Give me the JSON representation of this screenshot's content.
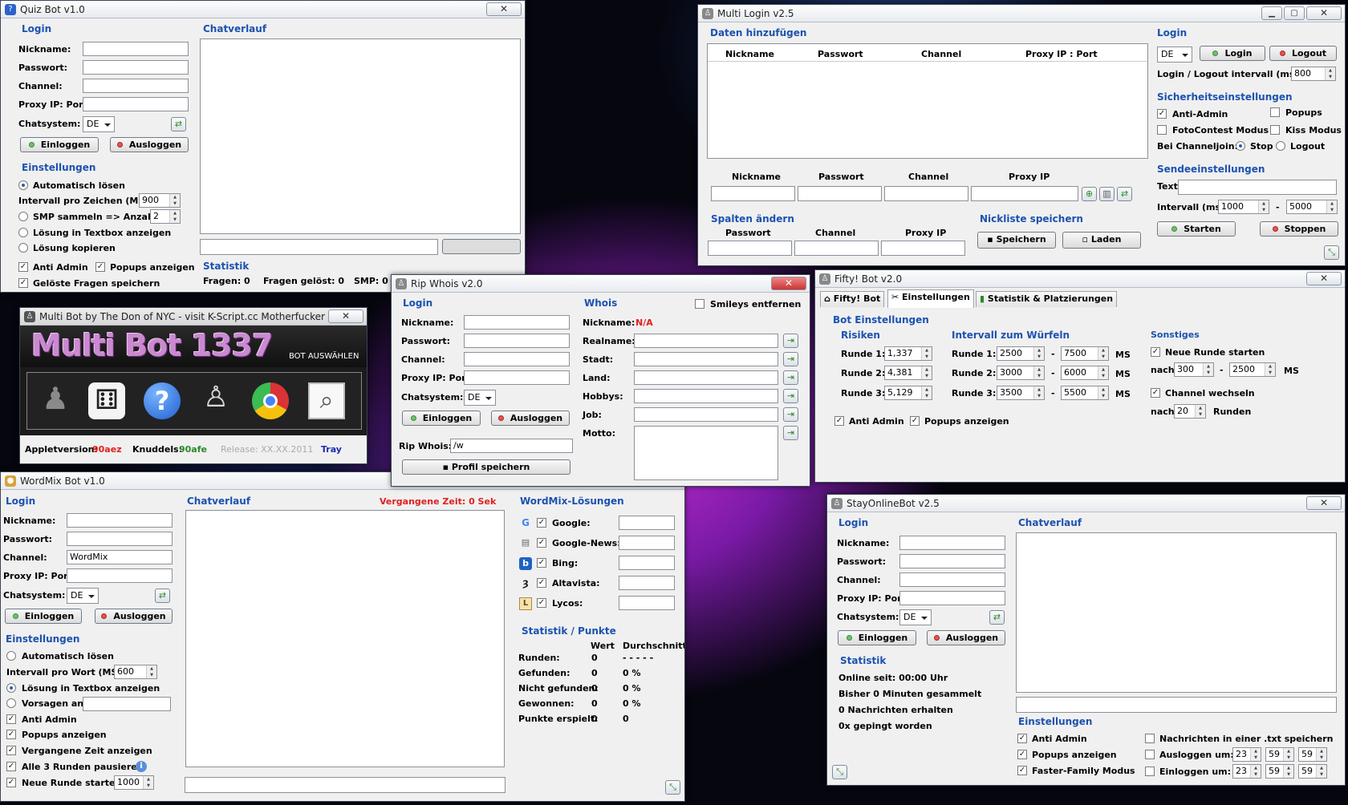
{
  "quiz": {
    "title": "Quiz Bot v1.0",
    "login": "Login",
    "nick": "Nickname:",
    "pass": "Passwort:",
    "channel": "Channel:",
    "proxy": "Proxy IP: Port:",
    "chat": "Chatsystem:",
    "chat_val": "DE",
    "einloggen": "Einloggen",
    "ausloggen": "Ausloggen",
    "einst": "Einstellungen",
    "auto": "Automatisch lösen",
    "interval": "Intervall pro Zeichen (MS):",
    "interval_val": "900",
    "smp": "SMP sammeln => Anzahl:",
    "smp_val": "2",
    "loes_tb": "Lösung in Textbox anzeigen",
    "loes_kop": "Lösung kopieren",
    "anti": "Anti Admin",
    "popups": "Popups anzeigen",
    "geloest": "Gelöste Fragen speichern",
    "chatverlauf": "Chatverlauf",
    "statistik": "Statistik",
    "fragen": "Fragen: 0",
    "fragen_gel": "Fragen gelöst: 0",
    "smp_stat": "SMP: 0"
  },
  "multilogin": {
    "title": "Multi Login v2.5",
    "daten": "Daten hinzufügen",
    "cols": [
      "Nickname",
      "Passwort",
      "Channel",
      "Proxy IP : Port"
    ],
    "cols2": [
      "Nickname",
      "Passwort",
      "Channel",
      "Proxy IP"
    ],
    "login": "Login",
    "lang": "DE",
    "login_btn": "Login",
    "logout_btn": "Logout",
    "interval_lbl": "Login / Logout intervall (ms):",
    "interval_val": "800",
    "sicher": "Sicherheitseinstellungen",
    "anti": "Anti-Admin",
    "popups": "Popups",
    "foto": "FotoContest Modus",
    "kiss": "Kiss Modus",
    "bei": "Bei Channeljoin:",
    "stop": "Stop",
    "logout": "Logout",
    "sende": "Sendeeinstellungen",
    "text": "Text",
    "intms": "Intervall (ms)",
    "int1": "1000",
    "dash": "-",
    "int2": "5000",
    "starten": "Starten",
    "stoppen": "Stoppen",
    "spalten": "Spalten ändern",
    "scol": [
      "Passwort",
      "Channel",
      "Proxy IP"
    ],
    "nickliste": "Nickliste speichern",
    "speichern": "Speichern",
    "laden": "Laden"
  },
  "multibot": {
    "title": "Multi Bot by The Don of NYC - visit K-Script.cc Motherfucker",
    "logo": "Multi Bot 1337",
    "bot_ausw": "BOT AUSWÄHLEN",
    "applet_lbl": "Appletversion:",
    "applet_val": "90aez",
    "knud_lbl": "Knuddels:",
    "knud_val": "90afe",
    "release": "Release: XX.XX.2011",
    "tray": "Tray"
  },
  "rip": {
    "title": "Rip Whois v2.0",
    "login": "Login",
    "nick": "Nickname:",
    "pass": "Passwort:",
    "channel": "Channel:",
    "proxy": "Proxy IP: Port:",
    "chat": "Chatsystem:",
    "chat_val": "DE",
    "einloggen": "Einloggen",
    "ausloggen": "Ausloggen",
    "whois_lbl": "Rip Whois:",
    "whois_val": "/w",
    "profil": "Profil speichern",
    "whois": "Whois",
    "smileys": "Smileys entfernen",
    "nick2": "Nickname:",
    "na": "N/A",
    "real": "Realname:",
    "stadt": "Stadt:",
    "land": "Land:",
    "hobbys": "Hobbys:",
    "job": "Job:",
    "motto": "Motto:"
  },
  "fifty": {
    "title": "Fifty! Bot v2.0",
    "tabs": [
      "Fifty! Bot",
      "Einstellungen",
      "Statistik & Platzierungen"
    ],
    "bot_einst": "Bot Einstellungen",
    "risiken": "Risiken",
    "r1": "Runde 1:",
    "r2": "Runde 2:",
    "r3": "Runde 3:",
    "rv1": "1,337",
    "rv2": "4,381",
    "rv3": "5,129",
    "intw": "Intervall zum Würfeln",
    "a1": "2500",
    "b1": "7500",
    "a2": "3000",
    "b2": "6000",
    "a3": "3500",
    "b3": "5500",
    "ms": "MS",
    "dash": "-",
    "sonst": "Sonstiges",
    "neue": "Neue Runde starten",
    "nach": "nach",
    "n1": "300",
    "n2": "2500",
    "chw": "Channel wechseln",
    "n3": "20",
    "runden": "Runden",
    "anti": "Anti Admin",
    "popups": "Popups anzeigen"
  },
  "wordmix": {
    "title": "WordMix Bot v1.0",
    "login": "Login",
    "nick": "Nickname:",
    "pass": "Passwort:",
    "channel": "Channel:",
    "channel_val": "WordMix",
    "proxy": "Proxy IP: Port:",
    "chat": "Chatsystem:",
    "chat_val": "DE",
    "einloggen": "Einloggen",
    "ausloggen": "Ausloggen",
    "einst": "Einstellungen",
    "auto": "Automatisch lösen",
    "interval": "Intervall pro Wort (MS):",
    "interval_val": "600",
    "loes": "Lösung in Textbox anzeigen",
    "vorsagen": "Vorsagen an:",
    "anti": "Anti Admin",
    "popups": "Popups anzeigen",
    "vergangene": "Vergangene Zeit anzeigen",
    "alle3": "Alle 3 Runden pausieren",
    "neue": "Neue Runde starten",
    "neue_val": "1000",
    "chatverlauf": "Chatverlauf",
    "zeit": "Vergangene Zeit: 0 Sek",
    "loesungen": "WordMix-Lösungen",
    "engines": [
      "Google:",
      "Google-News:",
      "Bing:",
      "Altavista:",
      "Lycos:"
    ],
    "stat": "Statistik / Punkte",
    "wert": "Wert",
    "durch": "Durchschnitt",
    "rows": [
      {
        "l": "Runden:",
        "w": "0",
        "d": "- - - - -"
      },
      {
        "l": "Gefunden:",
        "w": "0",
        "d": "0 %"
      },
      {
        "l": "Nicht gefunden:",
        "w": "0",
        "d": "0 %"
      },
      {
        "l": "Gewonnen:",
        "w": "0",
        "d": "0 %"
      },
      {
        "l": "Punkte erspielt:",
        "w": "0",
        "d": "0"
      }
    ]
  },
  "stay": {
    "title": "StayOnlineBot v2.5",
    "login": "Login",
    "nick": "Nickname:",
    "pass": "Passwort:",
    "channel": "Channel:",
    "proxy": "Proxy IP: Port:",
    "chat": "Chatsystem:",
    "chat_val": "DE",
    "einloggen": "Einloggen",
    "ausloggen": "Ausloggen",
    "statistik": "Statistik",
    "online": "Online seit: 00:00 Uhr",
    "bisher": "Bisher 0 Minuten gesammelt",
    "nachr": "0 Nachrichten erhalten",
    "gepingt": "0x gepingt worden",
    "chatverlauf": "Chatverlauf",
    "einst": "Einstellungen",
    "anti": "Anti Admin",
    "popups": "Popups anzeigen",
    "faster": "Faster-Family Modus",
    "txt": "Nachrichten in einer .txt speichern",
    "ausl": "Ausloggen um:",
    "einl": "Einloggen um:",
    "h": "23",
    "m": "59",
    "s": "59"
  }
}
